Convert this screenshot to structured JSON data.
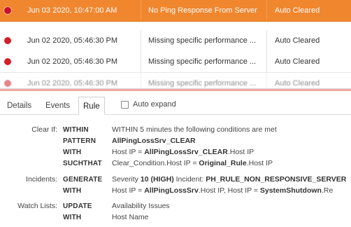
{
  "events": [
    {
      "time": "Jun 03 2020, 10:47:00 AM",
      "name": "No Ping Response From Server",
      "status": "Auto Cleared",
      "selected": true
    },
    {
      "time": "Jun 02 2020, 05:46:30 PM",
      "name": "Missing specific performance ...",
      "status": "Auto Cleared",
      "selected": false
    },
    {
      "time": "Jun 02 2020, 05:46:30 PM",
      "name": "Missing specific performance ...",
      "status": "Auto Cleared",
      "selected": false
    },
    {
      "time": "Jun 02 2020, 05:46:30 PM",
      "name": "Missing specific performance ...",
      "status": "Auto Cleared",
      "selected": false
    }
  ],
  "tabs": [
    "Details",
    "Events",
    "Rule"
  ],
  "active_tab": "Rule",
  "auto_expand_label": "Auto expand",
  "rule": {
    "clear_if": {
      "label": "Clear If:",
      "rows": [
        {
          "kw": "WITHIN",
          "text": "WITHIN 5 minutes the following conditions are met"
        },
        {
          "kw": "PATTERN",
          "text": "AllPingLossSrv_CLEAR"
        },
        {
          "kw": "WITH",
          "pre": "Host IP = ",
          "bold": "AllPingLossSrv_CLEAR",
          "post": ".Host IP"
        },
        {
          "kw": "SUCHTHAT",
          "pre": "Clear_Condition.Host IP = ",
          "bold": "Original_Rule",
          "post": ".Host IP"
        }
      ]
    },
    "incidents": {
      "label": "Incidents:",
      "rows": [
        {
          "kw": "GENERATE",
          "pre": "Severity ",
          "bold": "10 (HIGH)",
          "post": " Incident: ",
          "bold2": "PH_RULE_NON_RESPONSIVE_SERVER"
        },
        {
          "kw": "WITH",
          "pre": "Host IP = ",
          "bold": "AllPingLossSrv",
          "post": ".Host IP, Host IP = ",
          "bold2": "SystemShutdown",
          "post2": ".Re"
        }
      ]
    },
    "watch_lists": {
      "label": "Watch Lists:",
      "rows": [
        {
          "kw": "UPDATE",
          "text": "Availability Issues"
        },
        {
          "kw": "WITH",
          "text": "Host Name"
        }
      ]
    }
  }
}
